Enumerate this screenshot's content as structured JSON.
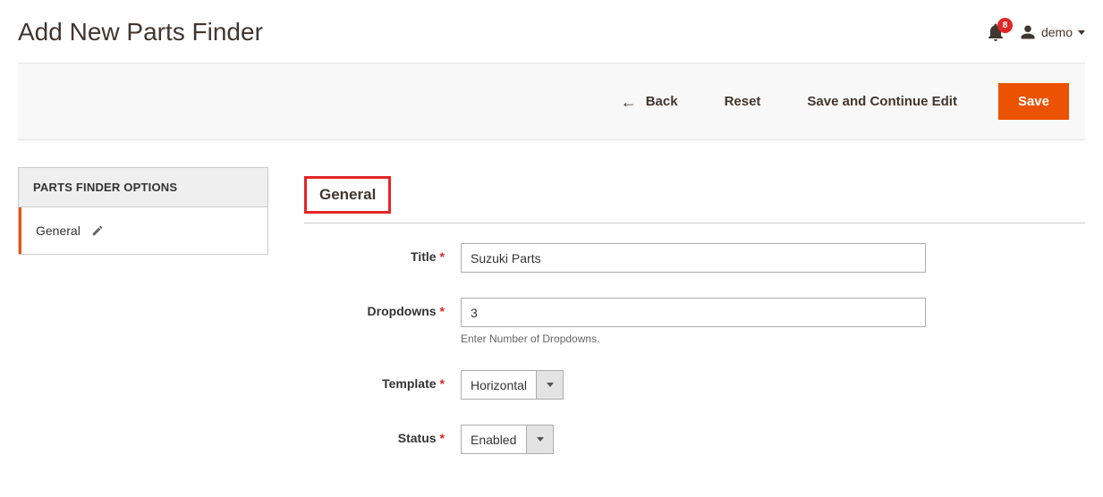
{
  "header": {
    "title": "Add New Parts Finder",
    "notif_count": "8",
    "user_name": "demo"
  },
  "actions": {
    "back": "Back",
    "reset": "Reset",
    "save_continue": "Save and Continue Edit",
    "save": "Save"
  },
  "sidebar": {
    "header": "PARTS FINDER OPTIONS",
    "items": [
      {
        "label": "General"
      }
    ]
  },
  "section": {
    "title": "General"
  },
  "form": {
    "title": {
      "label": "Title",
      "value": "Suzuki Parts"
    },
    "dropdowns": {
      "label": "Dropdowns",
      "value": "3",
      "hint": "Enter Number of Dropdowns."
    },
    "template": {
      "label": "Template",
      "value": "Horizontal"
    },
    "status": {
      "label": "Status",
      "value": "Enabled"
    }
  }
}
